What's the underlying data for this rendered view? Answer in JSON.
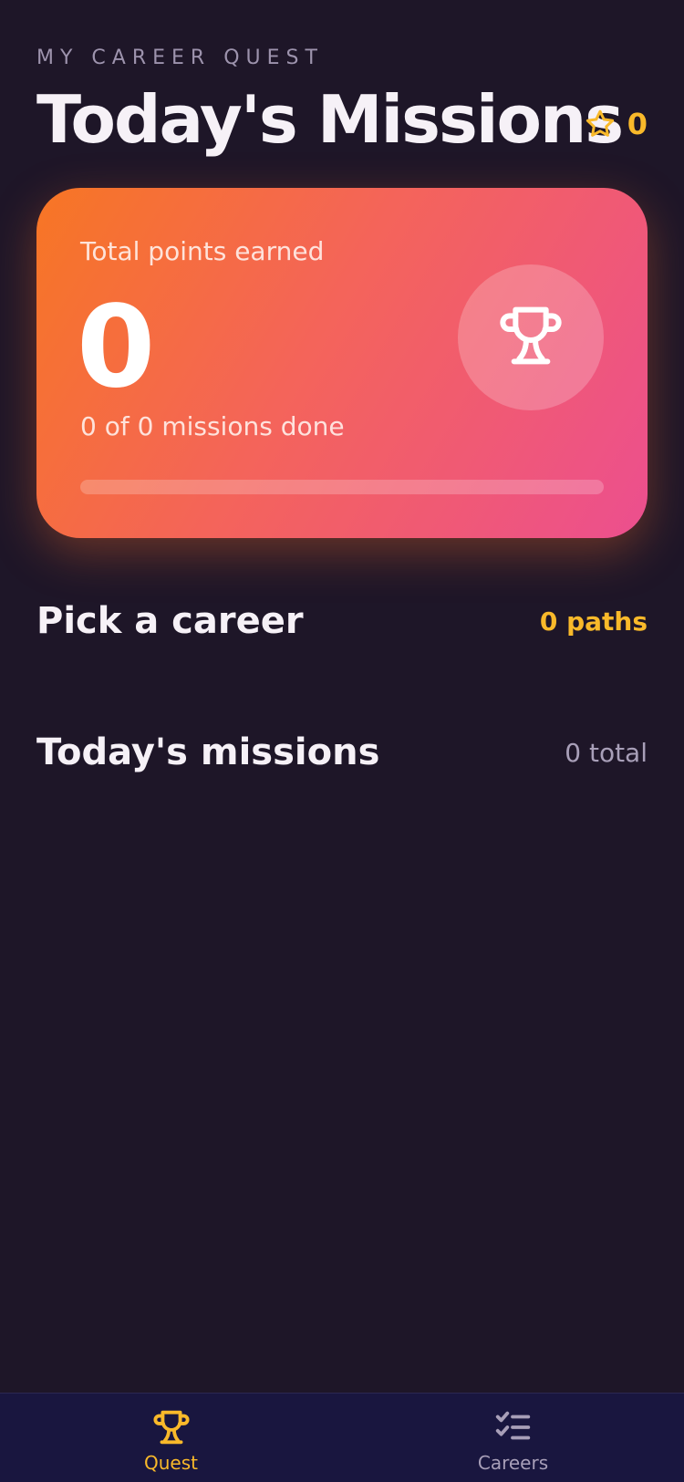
{
  "header": {
    "eyebrow": "MY CAREER QUEST",
    "title": "Today's Missions",
    "score": "0",
    "score_icon": "star-icon"
  },
  "points_card": {
    "label": "Total points earned",
    "points": "0",
    "progress_text": "0 of 0 missions done",
    "progress": 0,
    "icon": "trophy-icon"
  },
  "sections": {
    "careers": {
      "title": "Pick a career",
      "meta": "0 paths"
    },
    "missions": {
      "title": "Today's missions",
      "meta": "0 total"
    }
  },
  "bottom_nav": {
    "tabs": [
      {
        "label": "Quest",
        "icon": "trophy-icon",
        "active": true
      },
      {
        "label": "Careers",
        "icon": "checklist-icon",
        "active": false
      }
    ]
  },
  "colors": {
    "background": "#1e1628",
    "accent": "#f9b92a",
    "card_gradient_start": "#f77624",
    "card_gradient_end": "#ec4f8f",
    "nav_background": "#19163f"
  }
}
